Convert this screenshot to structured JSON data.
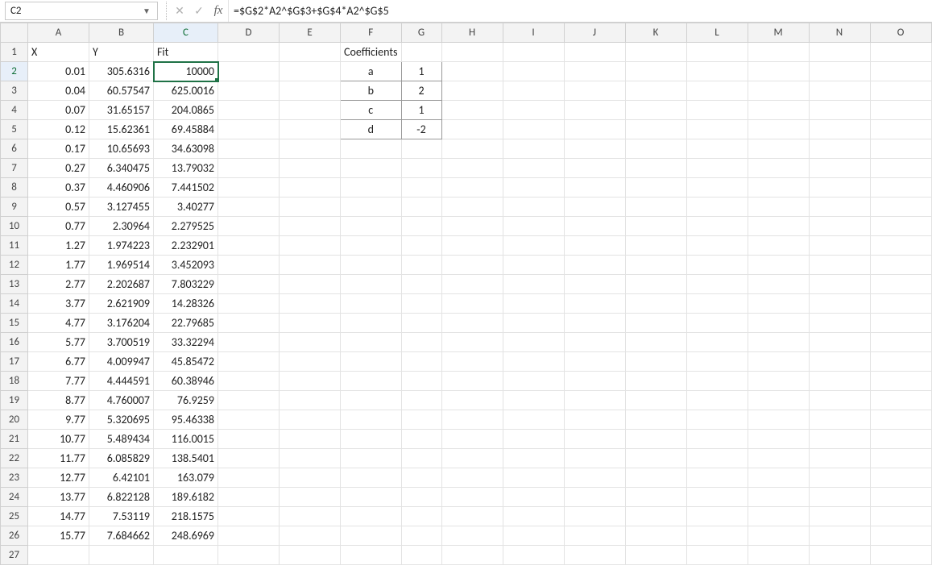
{
  "name_box": "C2",
  "formula": "=$G$2*A2^$G$3+$G$4*A2^$G$5",
  "columns": [
    "A",
    "B",
    "C",
    "D",
    "E",
    "F",
    "G",
    "H",
    "I",
    "J",
    "K",
    "L",
    "M",
    "N",
    "O"
  ],
  "headers": {
    "A": "X",
    "B": "Y",
    "C": "Fit"
  },
  "coefficients_label": "Coefficients",
  "coefficients": [
    {
      "name": "a",
      "value": "1"
    },
    {
      "name": "b",
      "value": "2"
    },
    {
      "name": "c",
      "value": "1"
    },
    {
      "name": "d",
      "value": "-2"
    }
  ],
  "rows": [
    {
      "x": "0.01",
      "y": "305.6316",
      "fit": "10000"
    },
    {
      "x": "0.04",
      "y": "60.57547",
      "fit": "625.0016"
    },
    {
      "x": "0.07",
      "y": "31.65157",
      "fit": "204.0865"
    },
    {
      "x": "0.12",
      "y": "15.62361",
      "fit": "69.45884"
    },
    {
      "x": "0.17",
      "y": "10.65693",
      "fit": "34.63098"
    },
    {
      "x": "0.27",
      "y": "6.340475",
      "fit": "13.79032"
    },
    {
      "x": "0.37",
      "y": "4.460906",
      "fit": "7.441502"
    },
    {
      "x": "0.57",
      "y": "3.127455",
      "fit": "3.40277"
    },
    {
      "x": "0.77",
      "y": "2.30964",
      "fit": "2.279525"
    },
    {
      "x": "1.27",
      "y": "1.974223",
      "fit": "2.232901"
    },
    {
      "x": "1.77",
      "y": "1.969514",
      "fit": "3.452093"
    },
    {
      "x": "2.77",
      "y": "2.202687",
      "fit": "7.803229"
    },
    {
      "x": "3.77",
      "y": "2.621909",
      "fit": "14.28326"
    },
    {
      "x": "4.77",
      "y": "3.176204",
      "fit": "22.79685"
    },
    {
      "x": "5.77",
      "y": "3.700519",
      "fit": "33.32294"
    },
    {
      "x": "6.77",
      "y": "4.009947",
      "fit": "45.85472"
    },
    {
      "x": "7.77",
      "y": "4.444591",
      "fit": "60.38946"
    },
    {
      "x": "8.77",
      "y": "4.760007",
      "fit": "76.9259"
    },
    {
      "x": "9.77",
      "y": "5.320695",
      "fit": "95.46338"
    },
    {
      "x": "10.77",
      "y": "5.489434",
      "fit": "116.0015"
    },
    {
      "x": "11.77",
      "y": "6.085829",
      "fit": "138.5401"
    },
    {
      "x": "12.77",
      "y": "6.42101",
      "fit": "163.079"
    },
    {
      "x": "13.77",
      "y": "6.822128",
      "fit": "189.6182"
    },
    {
      "x": "14.77",
      "y": "7.53119",
      "fit": "218.1575"
    },
    {
      "x": "15.77",
      "y": "7.684662",
      "fit": "248.6969"
    }
  ],
  "selected_cell": "C2",
  "total_rows_shown": 27
}
